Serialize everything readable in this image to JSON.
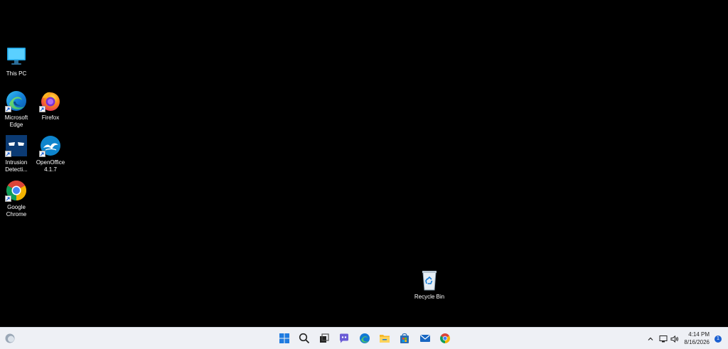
{
  "desktop": {
    "icons": [
      {
        "label": "This PC",
        "icon": "monitor-icon"
      },
      {
        "label": "Microsoft\nEdge",
        "icon": "edge-icon"
      },
      {
        "label": "Firefox",
        "icon": "firefox-icon"
      },
      {
        "label": "Intrusion\nDetecti...",
        "icon": "intrusion-detection-icon"
      },
      {
        "label": "OpenOffice\n4.1.7",
        "icon": "openoffice-icon"
      },
      {
        "label": "Google\nChrome",
        "icon": "chrome-icon"
      },
      {
        "label": "Recycle Bin",
        "icon": "recycle-bin-icon"
      }
    ],
    "background": "#000000"
  },
  "taskbar": {
    "widgets_icon": "weather-widget-icon",
    "pinned": [
      {
        "name": "start-button",
        "icon": "windows-logo-icon"
      },
      {
        "name": "search-button",
        "icon": "search-icon"
      },
      {
        "name": "task-view-button",
        "icon": "task-view-icon"
      },
      {
        "name": "chat-button",
        "icon": "chat-icon"
      },
      {
        "name": "edge-button",
        "icon": "edge-icon"
      },
      {
        "name": "file-explorer-button",
        "icon": "folder-icon"
      },
      {
        "name": "store-button",
        "icon": "store-icon"
      },
      {
        "name": "mail-button",
        "icon": "mail-icon"
      },
      {
        "name": "chrome-button",
        "icon": "chrome-icon"
      }
    ],
    "tray": {
      "chevron_icon": "chevron-up-icon",
      "network_icon": "network-icon",
      "volume_icon": "volume-icon",
      "time": "4:14 PM",
      "date": "8/16/2026",
      "notification_count": "1"
    }
  }
}
